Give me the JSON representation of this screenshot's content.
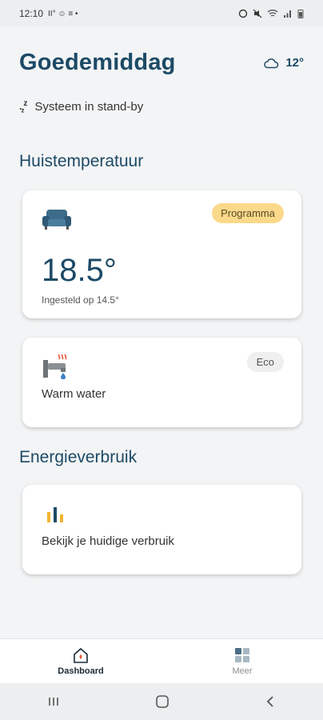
{
  "status_bar": {
    "time": "12:10",
    "left_glyphs": "II° ☺ ≡ •"
  },
  "header": {
    "greeting": "Goedemiddag",
    "temperature": "12°"
  },
  "system": {
    "status": "Systeem in stand-by"
  },
  "sections": {
    "house": "Huistemperatuur",
    "energy": "Energieverbruik"
  },
  "heating_card": {
    "badge": "Programma",
    "temperature": "18.5°",
    "setpoint": "Ingesteld op 14.5°"
  },
  "water_card": {
    "badge": "Eco",
    "label": "Warm water"
  },
  "energy_card": {
    "label": "Bekijk je huidige verbruik"
  },
  "bottom_nav": {
    "dashboard": "Dashboard",
    "more": "Meer"
  },
  "colors": {
    "accent": "#1c4a66",
    "badge_programma": "#fbd98a",
    "icon_red": "#e8553f"
  }
}
